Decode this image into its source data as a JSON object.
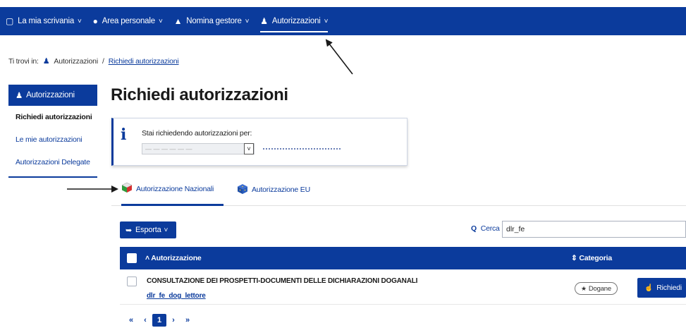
{
  "nav": {
    "items": [
      {
        "icon": "desk-icon",
        "glyph": "▢",
        "label": "La mia scrivania"
      },
      {
        "icon": "user-icon",
        "glyph": "●",
        "label": "Area personale"
      },
      {
        "icon": "building-icon",
        "glyph": "▲",
        "label": "Nomina gestore"
      },
      {
        "icon": "users-icon",
        "glyph": "♟",
        "label": "Autorizzazioni"
      }
    ],
    "chevron": "˅"
  },
  "breadcrumb": {
    "prefix": "Ti trovi in:",
    "first": "Autorizzazioni",
    "separator": "/",
    "current": "Richiedi autorizzazioni"
  },
  "sidebar": {
    "header": "Autorizzazioni",
    "items": [
      {
        "label": "Richiedi autorizzazioni"
      },
      {
        "label": "Le mie autorizzazioni"
      },
      {
        "label": "Autorizzazioni Delegate"
      }
    ]
  },
  "main": {
    "title": "Richiedi autorizzazioni",
    "info": {
      "text": "Stai richiedendo autorizzazioni per:",
      "select_value": "— — — —  — —"
    },
    "tabs": [
      {
        "label": "Autorizzazione Nazionali"
      },
      {
        "label": "Autorizzazione EU"
      }
    ],
    "toolbar": {
      "export_label": "Esporta",
      "search_label": "Cerca",
      "search_value": "dlr_fe"
    },
    "table": {
      "headers": {
        "auth": "Autorizzazione",
        "category": "Categoria"
      },
      "rows": [
        {
          "name": "CONSULTAZIONE DEI PROSPETTI-DOCUMENTI DELLE DICHIARAZIONI DOGANALI",
          "code": "dlr_fe_dog_lettore",
          "category": "Dogane",
          "action": "Richiedi"
        }
      ]
    },
    "pager": {
      "first": "«",
      "prev": "‹",
      "current": "1",
      "next": "›",
      "last": "»"
    }
  },
  "colors": {
    "primary": "#0b3b9c"
  }
}
